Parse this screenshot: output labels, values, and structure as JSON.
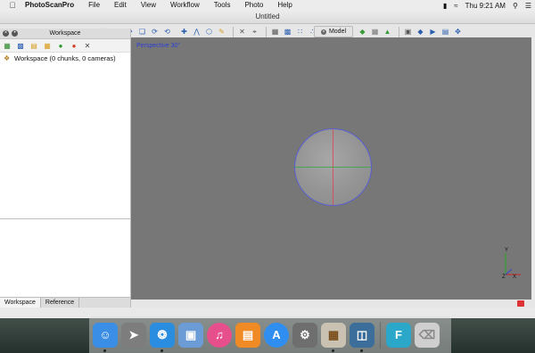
{
  "menubar": {
    "apple_icon": "apple-icon",
    "app_name": "PhotoScanPro",
    "items": [
      {
        "label": "File"
      },
      {
        "label": "Edit"
      },
      {
        "label": "View"
      },
      {
        "label": "Workflow"
      },
      {
        "label": "Tools"
      },
      {
        "label": "Photo"
      },
      {
        "label": "Help"
      }
    ],
    "clock": "Thu 9:21 AM"
  },
  "window": {
    "title": "Untitled"
  },
  "workspace": {
    "panel_title": "Workspace",
    "tree_root": "Workspace (0 chunks, 0 cameras)",
    "tabs": [
      {
        "label": "Workspace"
      },
      {
        "label": "Reference"
      }
    ]
  },
  "model": {
    "tab_label": "Model",
    "view_label": "Perspective 30°",
    "axis_labels": {
      "x": "X",
      "y": "Y",
      "z": "Z"
    },
    "colors": {
      "x_axis": "#cc2222",
      "y_axis": "#22aa22",
      "z_axis": "#3344cc",
      "viewport_bg": "#777777"
    }
  },
  "dock": {
    "apps": [
      {
        "name": "finder-icon",
        "letter": "",
        "color": "#3a8ee6",
        "running": true
      },
      {
        "name": "launchpad-icon",
        "letter": "",
        "color": "#8a8a8a",
        "running": false
      },
      {
        "name": "safari-icon",
        "letter": "",
        "color": "#2a8de0",
        "running": true
      },
      {
        "name": "preview-icon",
        "letter": "",
        "color": "#6b9cd6",
        "running": false
      },
      {
        "name": "itunes-icon",
        "letter": "",
        "color": "#e64f8c",
        "running": false
      },
      {
        "name": "ibooks-icon",
        "letter": "",
        "color": "#f08a24",
        "running": false
      },
      {
        "name": "app-store-icon",
        "letter": "",
        "color": "#2f8ef0",
        "running": false
      },
      {
        "name": "system-preferences-icon",
        "letter": "",
        "color": "#707070",
        "running": false
      },
      {
        "name": "installer-icon",
        "letter": "",
        "color": "#c9c2b2",
        "running": true
      },
      {
        "name": "photoscan-icon",
        "letter": "",
        "color": "#3b6e9a",
        "running": true
      }
    ],
    "others": [
      {
        "name": "fetch-icon",
        "letter": "F",
        "color": "#2aa7c9",
        "running": false
      },
      {
        "name": "trash-icon",
        "letter": "",
        "color": "#cfcfcf",
        "running": false
      }
    ]
  }
}
